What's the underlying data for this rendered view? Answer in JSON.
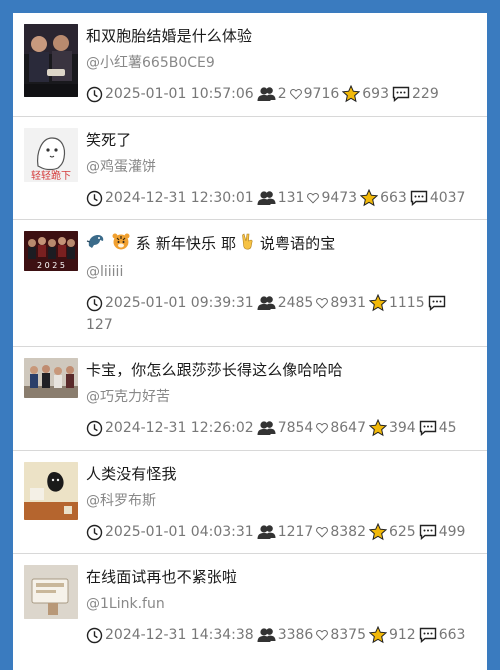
{
  "posts": [
    {
      "title": "和双胞胎结婚是什么体验",
      "author": "@小红薯665B0CE9",
      "datetime": "2025-01-01 10:57:06",
      "users": "2",
      "likes": "9716",
      "stars": "693",
      "comments": "229"
    },
    {
      "title": "笑死了",
      "author": "@鸡蛋灌饼",
      "datetime": "2024-12-31 12:30:01",
      "users": "131",
      "likes": "9473",
      "stars": "663",
      "comments": "4037"
    },
    {
      "title_suffix": "系 新年快乐 耶",
      "title_tail": "说粤语的宝",
      "author": "@liiiii",
      "datetime": "2025-01-01 09:39:31",
      "users": "2485",
      "likes": "8931",
      "stars": "1115",
      "comments": "127"
    },
    {
      "title": "卡宝，你怎么跟莎莎长得这么像哈哈哈",
      "author": "@巧克力好苦",
      "datetime": "2024-12-31 12:26:02",
      "users": "7854",
      "likes": "8647",
      "stars": "394",
      "comments": "45"
    },
    {
      "title": "人类没有怪我",
      "author": "@科罗布斯",
      "datetime": "2025-01-01 04:03:31",
      "users": "1217",
      "likes": "8382",
      "stars": "625",
      "comments": "499"
    },
    {
      "title": "在线面试再也不紧张啦",
      "author": "@1Link.fun",
      "datetime": "2024-12-31 14:34:38",
      "users": "3386",
      "likes": "8375",
      "stars": "912",
      "comments": "663"
    }
  ],
  "thumbnail_texts": {
    "post2_caption": "轻轻跪下",
    "post3_caption": "2 0 2 5"
  },
  "colors": {
    "page_background": "#3a7bbf",
    "card_background": "#ffffff",
    "title_text": "#1a1a1a",
    "meta_text": "#777777",
    "star": "#f2b90a"
  },
  "icons": [
    "clock-icon",
    "users-icon",
    "heart-icon",
    "star-icon",
    "comment-icon"
  ]
}
